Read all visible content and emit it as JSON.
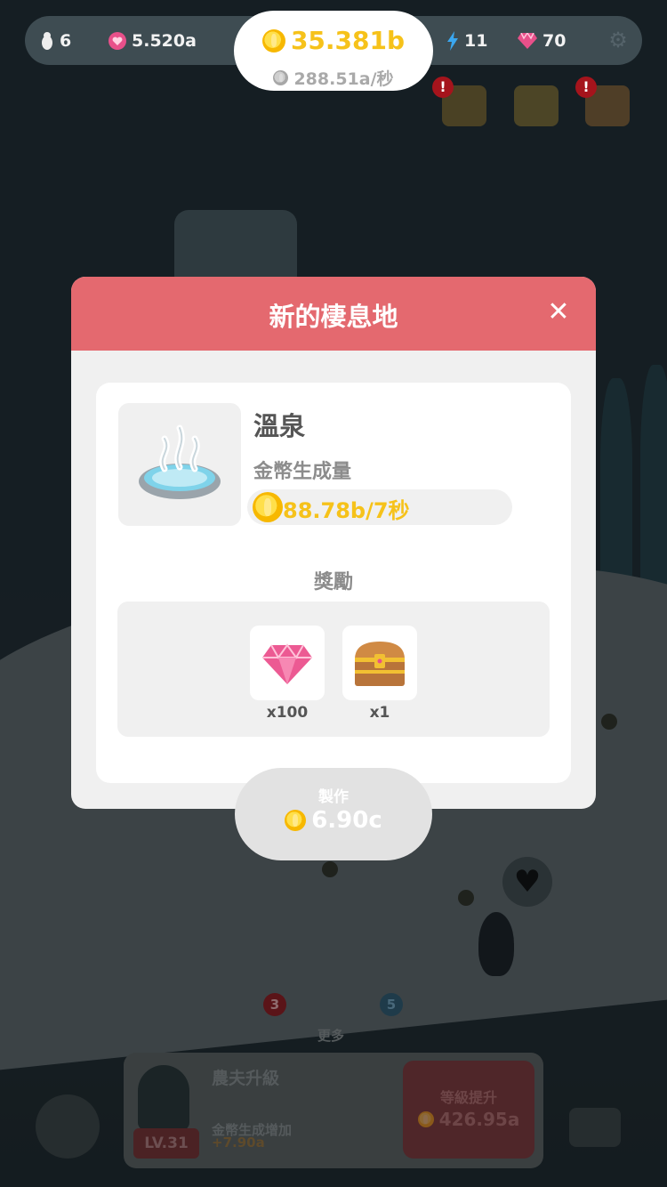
{
  "hud": {
    "penguins": "6",
    "hearts": "5.520a",
    "coins": "35.381b",
    "coin_rate": "288.51a/秒",
    "energy": "11",
    "gems": "70"
  },
  "modal": {
    "title": "新的棲息地",
    "close_icon": "✕",
    "habitat_name": "溫泉",
    "generation_label": "金幣生成量",
    "generation_rate": "88.78b/7秒",
    "rewards_title": "獎勵",
    "rewards": [
      {
        "icon": "gem-icon",
        "qty": "x100"
      },
      {
        "icon": "treasure-chest-icon",
        "qty": "x1"
      }
    ]
  },
  "make_button": {
    "label": "製作",
    "cost": "6.90c"
  },
  "bottom": {
    "badge_left": "3",
    "badge_right": "5",
    "more_label": "更多",
    "farmer_title": "農夫升級",
    "farmer_desc": "金幣生成增加",
    "farmer_bonus": "+7.90a",
    "level": "LV.31",
    "upgrade_label": "等級提升",
    "upgrade_cost": "426.95a"
  },
  "colors": {
    "header": "#e4696f",
    "coin_gold": "#f6c21a",
    "gem_pink": "#e8508a"
  }
}
